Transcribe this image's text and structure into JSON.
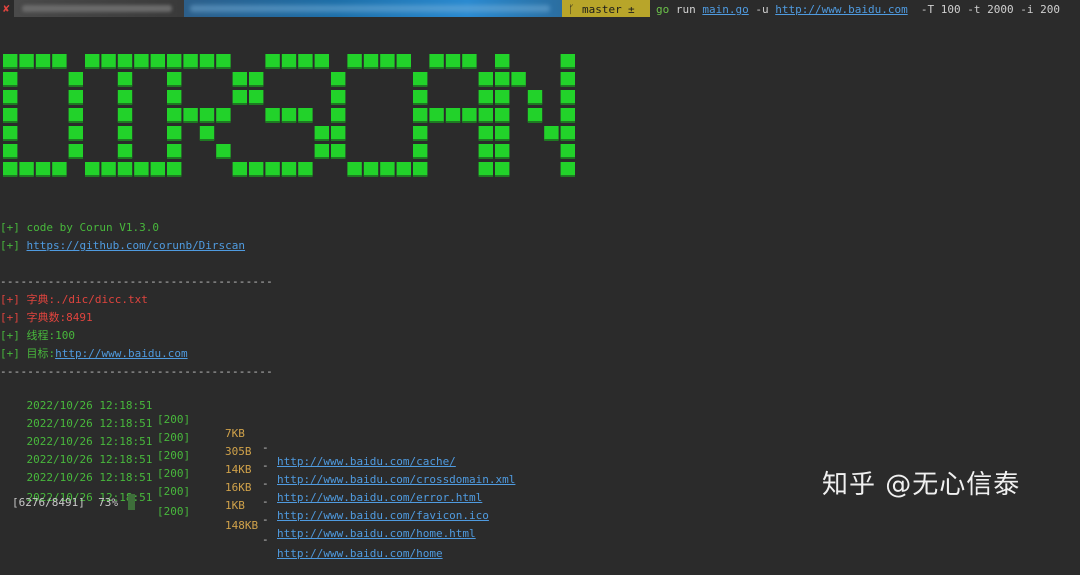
{
  "prompt": {
    "close_glyph": "✘",
    "branch": "master",
    "branch_symbol": "±",
    "git_glyph": "",
    "command_go": "go",
    "command_rest_1": " run ",
    "command_file": "main.go",
    "command_rest_2": " -u ",
    "command_url": "http://www.baidu.com",
    "command_args": "  -T 100 -t 2000 -i 200"
  },
  "banner": {
    "text": "DIRSCAN",
    "color": "#22d22a"
  },
  "info": {
    "code_by": "[+] code by Corun V1.3.0",
    "repo_prefix": "[+] ",
    "repo_url": "https://github.com/corunb/Dirscan",
    "separator": "----------------------------------------",
    "dict": "[+] 字典:./dic/dicc.txt",
    "dict_count": "[+] 字典数:8491",
    "threads": "[+] 线程:100",
    "target_prefix": "[+] 目标:",
    "target_url": "http://www.baidu.com",
    "separator2": "----------------------------------------"
  },
  "results": [
    {
      "time": "2022/10/26 12:18:51",
      "status": "[200]",
      "size": "7KB",
      "url": "http://www.baidu.com/cache/"
    },
    {
      "time": "2022/10/26 12:18:51",
      "status": "[200]",
      "size": "305B",
      "url": "http://www.baidu.com/crossdomain.xml"
    },
    {
      "time": "2022/10/26 12:18:51",
      "status": "[200]",
      "size": "14KB",
      "url": "http://www.baidu.com/error.html"
    },
    {
      "time": "2022/10/26 12:18:51",
      "status": "[200]",
      "size": "16KB",
      "url": "http://www.baidu.com/favicon.ico"
    },
    {
      "time": "2022/10/26 12:18:51",
      "status": "[200]",
      "size": "1KB",
      "url": "http://www.baidu.com/home.html"
    },
    {
      "time": "2022/10/26 12:18:51",
      "status": "[200]",
      "size": "148KB",
      "url": "http://www.baidu.com/home"
    }
  ],
  "progress": {
    "text": "[6276/8491]  73%"
  },
  "watermark": "知乎 @无心信泰"
}
